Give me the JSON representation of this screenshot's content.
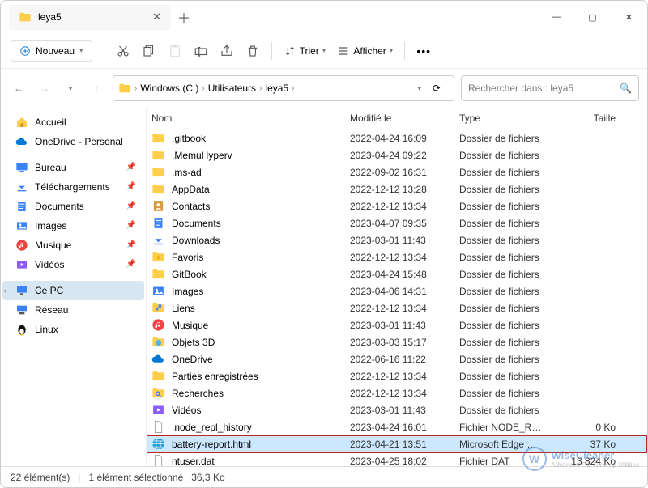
{
  "window": {
    "title": "leya5"
  },
  "toolbar": {
    "new": "Nouveau",
    "sort": "Trier",
    "view": "Afficher"
  },
  "breadcrumb": {
    "drive": "Windows (C:)",
    "users": "Utilisateurs",
    "current": "leya5"
  },
  "search": {
    "placeholder": "Rechercher dans : leya5"
  },
  "columns": {
    "name": "Nom",
    "modified": "Modifié le",
    "type": "Type",
    "size": "Taille"
  },
  "sidebar": {
    "home": "Accueil",
    "onedrive": "OneDrive - Personal",
    "items": [
      {
        "label": "Bureau"
      },
      {
        "label": "Téléchargements"
      },
      {
        "label": "Documents"
      },
      {
        "label": "Images"
      },
      {
        "label": "Musique"
      },
      {
        "label": "Vidéos"
      }
    ],
    "thispc": "Ce PC",
    "network": "Réseau",
    "linux": "Linux"
  },
  "files": [
    {
      "icon": "folder",
      "name": ".gitbook",
      "mod": "2022-04-24 16:09",
      "type": "Dossier de fichiers",
      "size": ""
    },
    {
      "icon": "folder",
      "name": ".MemuHyperv",
      "mod": "2023-04-24 09:22",
      "type": "Dossier de fichiers",
      "size": ""
    },
    {
      "icon": "folder",
      "name": ".ms-ad",
      "mod": "2022-09-02 16:31",
      "type": "Dossier de fichiers",
      "size": ""
    },
    {
      "icon": "folder",
      "name": "AppData",
      "mod": "2022-12-12 13:28",
      "type": "Dossier de fichiers",
      "size": ""
    },
    {
      "icon": "contacts",
      "name": "Contacts",
      "mod": "2022-12-12 13:34",
      "type": "Dossier de fichiers",
      "size": ""
    },
    {
      "icon": "docs",
      "name": "Documents",
      "mod": "2023-04-07 09:35",
      "type": "Dossier de fichiers",
      "size": ""
    },
    {
      "icon": "downloads",
      "name": "Downloads",
      "mod": "2023-03-01 11:43",
      "type": "Dossier de fichiers",
      "size": ""
    },
    {
      "icon": "favs",
      "name": "Favoris",
      "mod": "2022-12-12 13:34",
      "type": "Dossier de fichiers",
      "size": ""
    },
    {
      "icon": "folder",
      "name": "GitBook",
      "mod": "2023-04-24 15:48",
      "type": "Dossier de fichiers",
      "size": ""
    },
    {
      "icon": "images",
      "name": "Images",
      "mod": "2023-04-06 14:31",
      "type": "Dossier de fichiers",
      "size": ""
    },
    {
      "icon": "links",
      "name": "Liens",
      "mod": "2022-12-12 13:34",
      "type": "Dossier de fichiers",
      "size": ""
    },
    {
      "icon": "music",
      "name": "Musique",
      "mod": "2023-03-01 11:43",
      "type": "Dossier de fichiers",
      "size": ""
    },
    {
      "icon": "objects3d",
      "name": "Objets 3D",
      "mod": "2023-03-03 15:17",
      "type": "Dossier de fichiers",
      "size": ""
    },
    {
      "icon": "onedrive",
      "name": "OneDrive",
      "mod": "2022-06-16 11:22",
      "type": "Dossier de fichiers",
      "size": ""
    },
    {
      "icon": "folder",
      "name": "Parties enregistrées",
      "mod": "2022-12-12 13:34",
      "type": "Dossier de fichiers",
      "size": ""
    },
    {
      "icon": "search",
      "name": "Recherches",
      "mod": "2022-12-12 13:34",
      "type": "Dossier de fichiers",
      "size": ""
    },
    {
      "icon": "videos",
      "name": "Vidéos",
      "mod": "2023-03-01 11:43",
      "type": "Dossier de fichiers",
      "size": ""
    },
    {
      "icon": "file",
      "name": ".node_repl_history",
      "mod": "2023-04-24 16:01",
      "type": "Fichier NODE_REP...",
      "size": "0 Ko"
    },
    {
      "icon": "html",
      "name": "battery-report.html",
      "mod": "2023-04-21 13:51",
      "type": "Microsoft Edge De...",
      "size": "37 Ko",
      "highlight": true
    },
    {
      "icon": "file",
      "name": "ntuser.dat",
      "mod": "2023-04-25 18:02",
      "type": "Fichier DAT",
      "size": "13 824 Ko"
    }
  ],
  "status": {
    "count": "22 élément(s)",
    "selected": "1 élément sélectionné",
    "selsize": "36,3 Ko"
  },
  "watermark": {
    "brand": "WiseCleaner",
    "sub": "Advanced PC Tune-up Utilities"
  }
}
